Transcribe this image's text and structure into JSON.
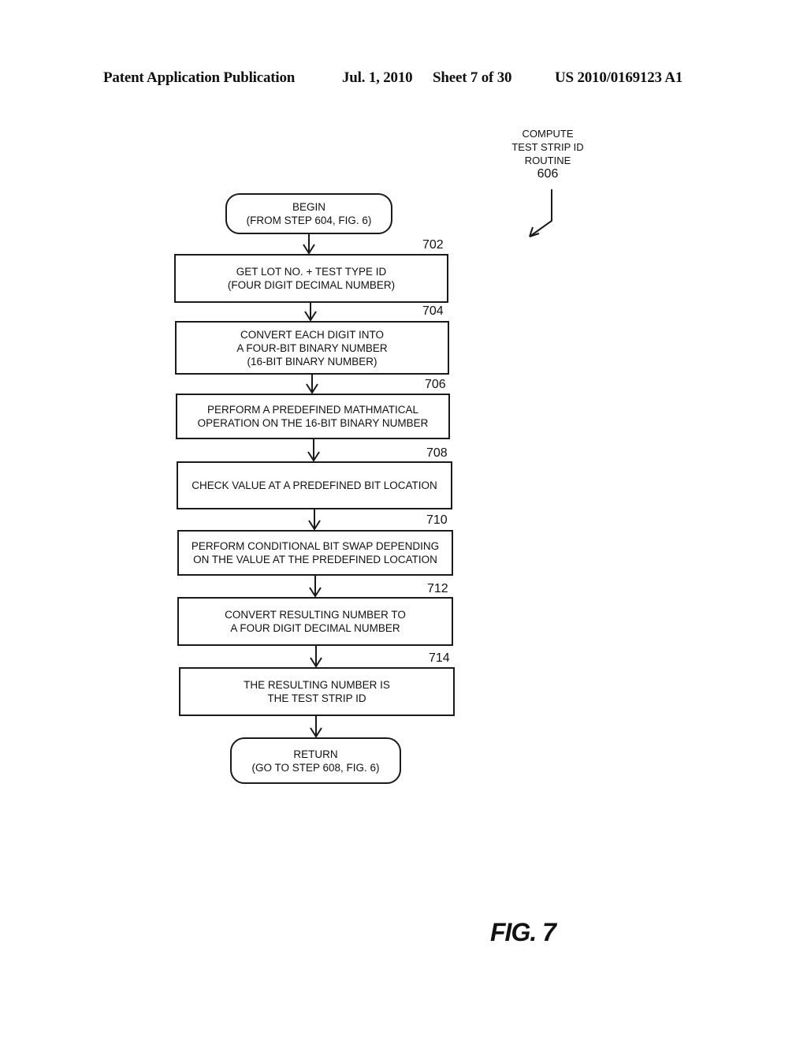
{
  "header": {
    "publication": "Patent Application Publication",
    "date": "Jul. 1, 2010",
    "sheet": "Sheet 7 of 30",
    "number": "US 2010/0169123 A1"
  },
  "routine": {
    "line1": "COMPUTE",
    "line2": "TEST STRIP  ID",
    "line3": "ROUTINE",
    "ref": "606"
  },
  "flow": {
    "begin": {
      "text": "BEGIN\n(FROM STEP 604, FIG. 6)"
    },
    "steps": [
      {
        "ref": "702",
        "text": "GET LOT NO. + TEST TYPE ID\n(FOUR DIGIT DECIMAL NUMBER)"
      },
      {
        "ref": "704",
        "text": "CONVERT  EACH DIGIT INTO\nA FOUR-BIT BINARY NUMBER\n(16-BIT BINARY NUMBER)"
      },
      {
        "ref": "706",
        "text": "PERFORM A PREDEFINED MATHMATICAL\nOPERATION ON THE 16-BIT BINARY NUMBER"
      },
      {
        "ref": "708",
        "text": "CHECK VALUE AT A PREDEFINED BIT LOCATION"
      },
      {
        "ref": "710",
        "text": "PERFORM CONDITIONAL BIT SWAP DEPENDING\nON THE VALUE AT THE PREDEFINED LOCATION"
      },
      {
        "ref": "712",
        "text": "CONVERT  RESULTING NUMBER TO\nA  FOUR DIGIT DECIMAL NUMBER"
      },
      {
        "ref": "714",
        "text": "THE RESULTING NUMBER IS\nTHE  TEST STRIP ID"
      }
    ],
    "end": {
      "text": "RETURN\n(GO TO STEP 608, FIG. 6)"
    }
  },
  "figure_label": "FIG. 7"
}
